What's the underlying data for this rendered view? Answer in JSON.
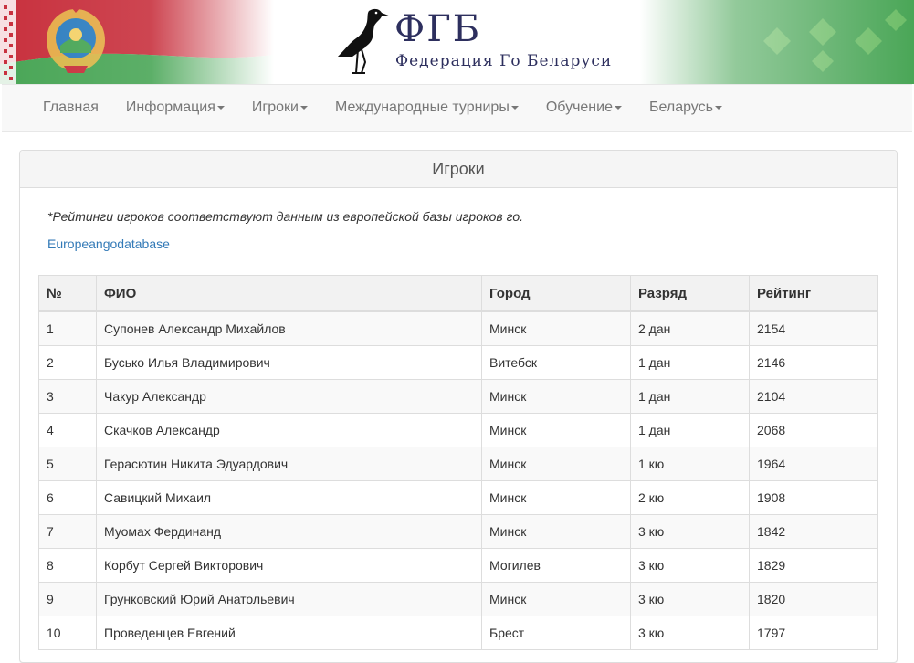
{
  "header": {
    "logo_title": "ФГБ",
    "logo_subtitle": "Федерация Го Беларуси"
  },
  "nav": {
    "items": [
      {
        "label": "Главная",
        "dropdown": false
      },
      {
        "label": "Информация",
        "dropdown": true
      },
      {
        "label": "Игроки",
        "dropdown": true
      },
      {
        "label": "Международные турниры",
        "dropdown": true
      },
      {
        "label": "Обучение",
        "dropdown": true
      },
      {
        "label": "Беларусь",
        "dropdown": true
      }
    ]
  },
  "panel": {
    "title": "Игроки",
    "note": "*Рейтинги игроков соответствуют данным из европейской базы игроков го.",
    "link_text": "Europeangodatabase"
  },
  "table": {
    "headers": [
      "№",
      "ФИО",
      "Город",
      "Разряд",
      "Рейтинг"
    ],
    "rows": [
      [
        "1",
        "Супонев Александр Михайлов",
        "Минск",
        "2 дан",
        "2154"
      ],
      [
        "2",
        "Бусько Илья Владимирович",
        "Витебск",
        "1 дан",
        "2146"
      ],
      [
        "3",
        "Чакур Александр",
        "Минск",
        "1 дан",
        "2104"
      ],
      [
        "4",
        "Скачков Александр",
        "Минск",
        "1 дан",
        "2068"
      ],
      [
        "5",
        "Герасютин Никита Эдуардович",
        "Минск",
        "1 кю",
        "1964"
      ],
      [
        "6",
        "Савицкий Михаил",
        "Минск",
        "2 кю",
        "1908"
      ],
      [
        "7",
        "Муомах Фердинанд",
        "Минск",
        "3 кю",
        "1842"
      ],
      [
        "8",
        "Корбут Сергей Викторович",
        "Могилев",
        "3 кю",
        "1829"
      ],
      [
        "9",
        "Грунковский Юрий Анатольевич",
        "Минск",
        "3 кю",
        "1820"
      ],
      [
        "10",
        "Проведенцев Евгений",
        "Брест",
        "3 кю",
        "1797"
      ]
    ]
  },
  "colors": {
    "flag_red": "#c8313e",
    "flag_green": "#4aa657",
    "logo_navy": "#2d2f5e",
    "link_blue": "#337ab7"
  }
}
